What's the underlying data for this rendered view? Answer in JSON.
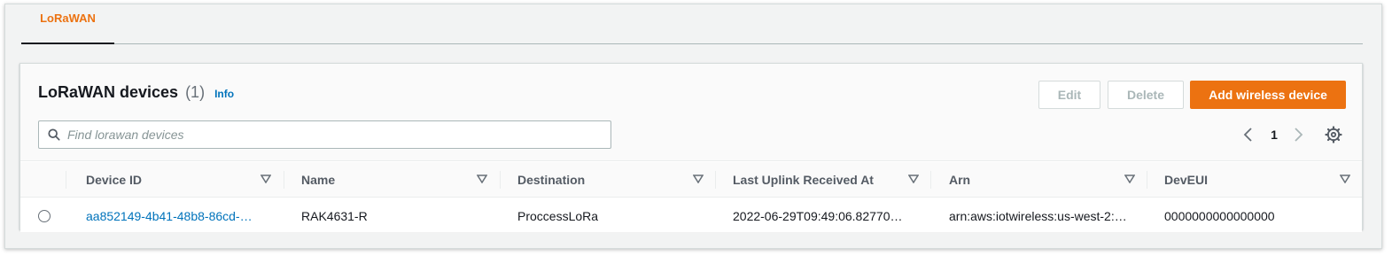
{
  "tabs": [
    {
      "label": "LoRaWAN"
    }
  ],
  "panel": {
    "title": "LoRaWAN devices",
    "count": "(1)",
    "info_label": "Info",
    "buttons": {
      "edit": "Edit",
      "delete": "Delete",
      "add": "Add wireless device"
    },
    "search": {
      "placeholder": "Find lorawan devices",
      "value": ""
    },
    "pagination": {
      "current_page": "1"
    }
  },
  "table": {
    "columns": [
      "Device ID",
      "Name",
      "Destination",
      "Last Uplink Received At",
      "Arn",
      "DevEUI"
    ],
    "rows": [
      {
        "device_id": "aa852149-4b41-48b8-86cd-…",
        "name": "RAK4631-R",
        "destination": "ProccessLoRa",
        "last_uplink": "2022-06-29T09:49:06.82770…",
        "arn": "arn:aws:iotwireless:us-west-2:…",
        "deveui": "0000000000000000"
      }
    ]
  },
  "colors": {
    "accent": "#ec7211",
    "link": "#0073bb",
    "text": "#16191f",
    "muted": "#687078"
  }
}
